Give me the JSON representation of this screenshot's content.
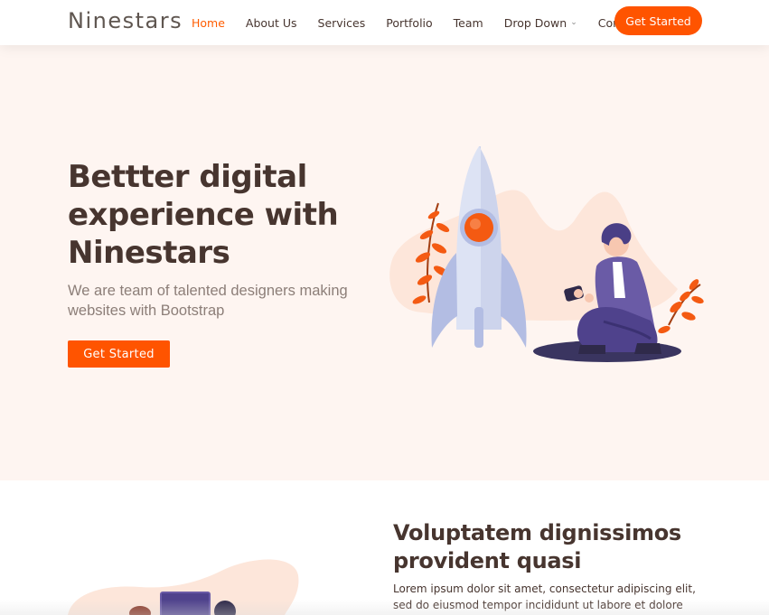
{
  "header": {
    "logo": "Ninestars",
    "nav": [
      {
        "label": "Home"
      },
      {
        "label": "About Us"
      },
      {
        "label": "Services"
      },
      {
        "label": "Portfolio"
      },
      {
        "label": "Team"
      },
      {
        "label": "Drop Down"
      },
      {
        "label": "Contact"
      }
    ],
    "cta_label": "Get Started"
  },
  "hero": {
    "title": "Bettter digital experience with Ninestars",
    "subtitle": "We are team of talented designers making websites with Bootstrap",
    "button_label": "Get Started"
  },
  "about": {
    "title": "Voluptatem dignissimos provident quasi",
    "text": "Lorem ipsum dolor sit amet, consectetur adipiscing elit, sed do eiusmod tempor incididunt ut labore et dolore magna aliqua."
  },
  "colors": {
    "accent": "#ff5400",
    "hero_bg": "#fef5f1",
    "heading": "#47352f"
  }
}
